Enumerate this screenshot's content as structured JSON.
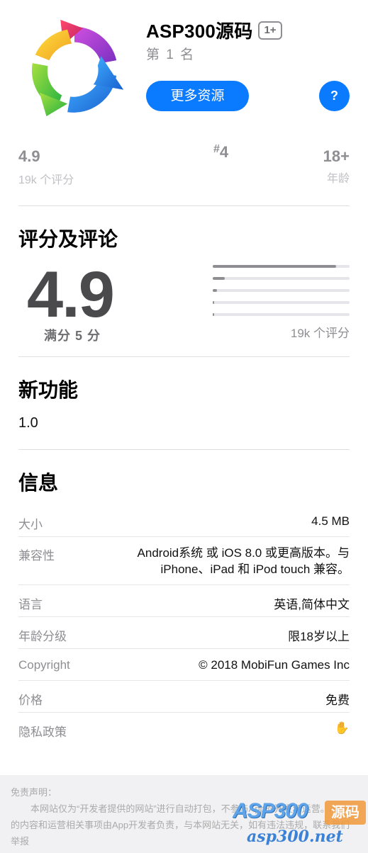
{
  "app": {
    "title": "ASP300源码",
    "age_badge": "1+",
    "rank_text": "第 1 名",
    "more_button": "更多资源",
    "help_button": "?",
    "icon": "refresh-cycle-icon"
  },
  "stats": {
    "rating": "4.9",
    "rating_sub": "19k 个评分",
    "rank_hash": "#",
    "rank_num": "4",
    "age": "18+",
    "age_sub": "年龄"
  },
  "ratings": {
    "title": "评分及评论",
    "score": "4.9",
    "out_of": "满分 5 分",
    "count": "19k 个评分",
    "distribution": [
      0.9,
      0.09,
      0.03,
      0.01,
      0.01
    ]
  },
  "whats_new": {
    "title": "新功能",
    "version": "1.0"
  },
  "info": {
    "title": "信息",
    "rows": [
      {
        "label": "大小",
        "value": "4.5 MB"
      },
      {
        "label": "兼容性",
        "value_line1": "Android系统 或 iOS 8.0 或更高版本。与",
        "value_line2": "iPhone、iPad 和 iPod touch 兼容。"
      },
      {
        "label": "语言",
        "value": "英语,简体中文"
      },
      {
        "label": "年龄分级",
        "value": "限18岁以上"
      },
      {
        "label": "Copyright",
        "value": "© 2018 MobiFun Games Inc"
      },
      {
        "label": "价格",
        "value": "免费"
      },
      {
        "label": "隐私政策",
        "icon": "hand-icon"
      }
    ]
  },
  "footer": {
    "title": "免责声明：",
    "body": "本网站仅为“开发者提供的网站”进行自动打包，不参与App的开发和运营。App内的内容和运营相关事项由App开发者负责，与本网站无关，如有违法违规，联系我们举报",
    "watermark_top": "ASP300",
    "watermark_tag": "源码",
    "watermark_bottom": "asp300.net"
  },
  "colors": {
    "accent": "#0a7aff",
    "secondary_text": "#8e8e93"
  }
}
